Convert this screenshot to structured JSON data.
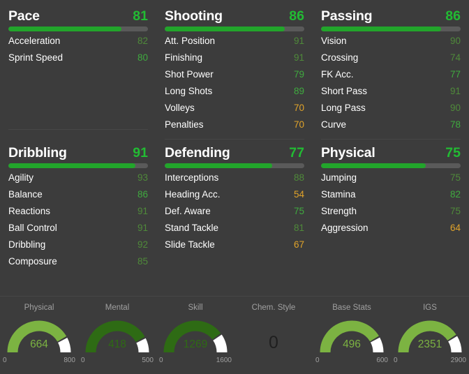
{
  "colors": {
    "background": "#3c3c3c",
    "title_text": "#ffffff",
    "rating_green": "#22bb33",
    "bar_fill": "#22a52b",
    "bar_track": "#5a5a5a",
    "value_high": "#3faa3f",
    "value_mid": "#4f8a3a",
    "value_low": "#e0a32a",
    "gauge_bright": "#7cb342",
    "gauge_dark": "#2e6b14",
    "gauge_remainder": "#ffffff",
    "axis_label": "#a0a0a0",
    "divider": "#474747"
  },
  "stat_groups": [
    {
      "name": "pace",
      "title": "Pace",
      "rating": 81,
      "bar_percent": 81,
      "attributes": [
        {
          "label": "Acceleration",
          "value": 82,
          "tone": "mid"
        },
        {
          "label": "Sprint Speed",
          "value": 80,
          "tone": "high"
        }
      ]
    },
    {
      "name": "shooting",
      "title": "Shooting",
      "rating": 86,
      "bar_percent": 86,
      "attributes": [
        {
          "label": "Att. Position",
          "value": 91,
          "tone": "mid"
        },
        {
          "label": "Finishing",
          "value": 91,
          "tone": "mid"
        },
        {
          "label": "Shot Power",
          "value": 79,
          "tone": "high"
        },
        {
          "label": "Long Shots",
          "value": 89,
          "tone": "high"
        },
        {
          "label": "Volleys",
          "value": 70,
          "tone": "low"
        },
        {
          "label": "Penalties",
          "value": 70,
          "tone": "low"
        }
      ]
    },
    {
      "name": "passing",
      "title": "Passing",
      "rating": 86,
      "bar_percent": 86,
      "attributes": [
        {
          "label": "Vision",
          "value": 90,
          "tone": "mid"
        },
        {
          "label": "Crossing",
          "value": 74,
          "tone": "mid"
        },
        {
          "label": "FK Acc.",
          "value": 77,
          "tone": "high"
        },
        {
          "label": "Short Pass",
          "value": 91,
          "tone": "mid"
        },
        {
          "label": "Long Pass",
          "value": 90,
          "tone": "mid"
        },
        {
          "label": "Curve",
          "value": 78,
          "tone": "high"
        }
      ]
    },
    {
      "name": "dribbling",
      "title": "Dribbling",
      "rating": 91,
      "bar_percent": 91,
      "attributes": [
        {
          "label": "Agility",
          "value": 93,
          "tone": "mid"
        },
        {
          "label": "Balance",
          "value": 86,
          "tone": "high"
        },
        {
          "label": "Reactions",
          "value": 91,
          "tone": "mid"
        },
        {
          "label": "Ball Control",
          "value": 91,
          "tone": "mid"
        },
        {
          "label": "Dribbling",
          "value": 92,
          "tone": "mid"
        },
        {
          "label": "Composure",
          "value": 85,
          "tone": "mid"
        }
      ]
    },
    {
      "name": "defending",
      "title": "Defending",
      "rating": 77,
      "bar_percent": 77,
      "attributes": [
        {
          "label": "Interceptions",
          "value": 88,
          "tone": "mid"
        },
        {
          "label": "Heading Acc.",
          "value": 54,
          "tone": "low"
        },
        {
          "label": "Def. Aware",
          "value": 75,
          "tone": "high"
        },
        {
          "label": "Stand Tackle",
          "value": 81,
          "tone": "mid"
        },
        {
          "label": "Slide Tackle",
          "value": 67,
          "tone": "low"
        }
      ]
    },
    {
      "name": "physical",
      "title": "Physical",
      "rating": 75,
      "bar_percent": 75,
      "attributes": [
        {
          "label": "Jumping",
          "value": 75,
          "tone": "mid"
        },
        {
          "label": "Stamina",
          "value": 82,
          "tone": "high"
        },
        {
          "label": "Strength",
          "value": 75,
          "tone": "mid"
        },
        {
          "label": "Aggression",
          "value": 64,
          "tone": "low"
        }
      ]
    }
  ],
  "gauges": [
    {
      "name": "physical-total",
      "label": "Physical",
      "value": 664,
      "min": 0,
      "max": 800,
      "min_label": "0",
      "max_label": "800",
      "style": "bright",
      "kind": "gauge"
    },
    {
      "name": "mental-total",
      "label": "Mental",
      "value": 418,
      "min": 0,
      "max": 500,
      "min_label": "0",
      "max_label": "500",
      "style": "dark",
      "kind": "gauge"
    },
    {
      "name": "skill-total",
      "label": "Skill",
      "value": 1269,
      "min": 0,
      "max": 1600,
      "min_label": "0",
      "max_label": "1600",
      "style": "dark",
      "kind": "gauge"
    },
    {
      "name": "chem-style",
      "label": "Chem. Style",
      "value": 0,
      "kind": "plain"
    },
    {
      "name": "base-stats-total",
      "label": "Base Stats",
      "value": 496,
      "min": 0,
      "max": 600,
      "min_label": "0",
      "max_label": "600",
      "style": "bright",
      "kind": "gauge"
    },
    {
      "name": "igs-total",
      "label": "IGS",
      "value": 2351,
      "min": 0,
      "max": 2900,
      "min_label": "0",
      "max_label": "2900",
      "style": "bright",
      "kind": "gauge"
    }
  ]
}
